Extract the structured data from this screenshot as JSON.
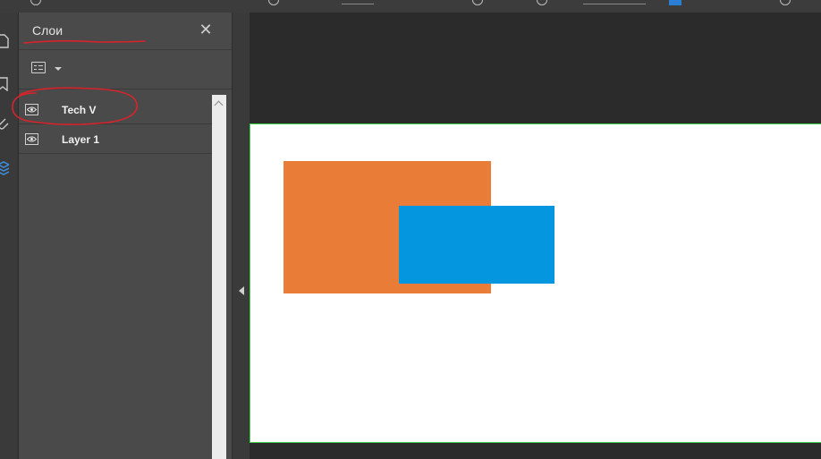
{
  "panel": {
    "title": "Слои",
    "close_icon": "close-icon",
    "options_icon": "layer-options-icon",
    "layers": [
      {
        "name": "Tech V",
        "visible": true
      },
      {
        "name": "Layer 1",
        "visible": true
      }
    ]
  },
  "colors": {
    "orange_rect": "#E97C36",
    "blue_rect": "#0497DF",
    "page_border": "#3FD24A",
    "annotation": "#D9232B"
  }
}
